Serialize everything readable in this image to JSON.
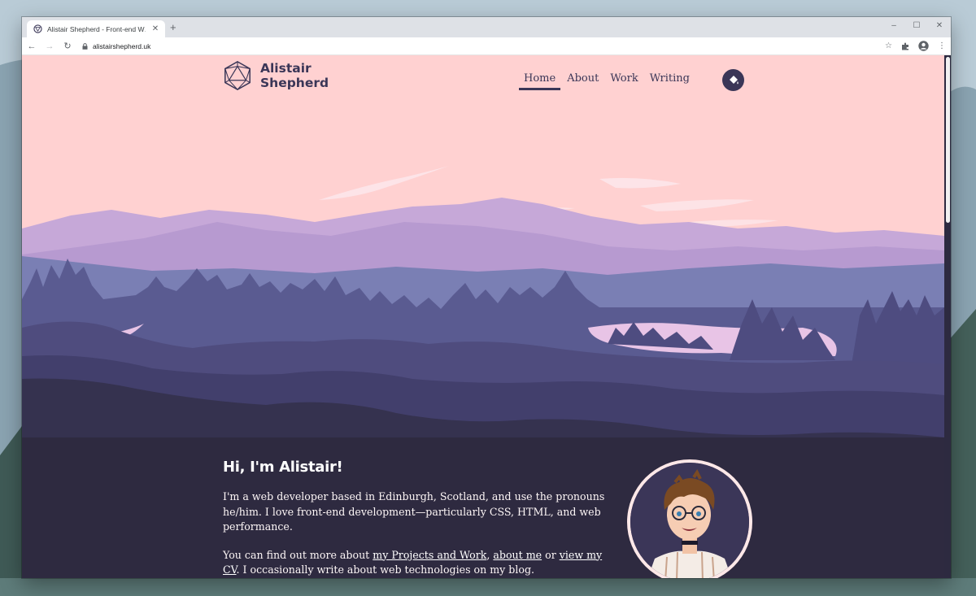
{
  "browser": {
    "tab_title": "Alistair Shepherd - Front-end W…",
    "tab_close": "✕",
    "new_tab": "+",
    "url": "alistairshepherd.uk",
    "controls": {
      "minimize": "–",
      "maximize": "☐",
      "close": "✕"
    }
  },
  "site": {
    "logo_line1": "Alistair",
    "logo_line2": "Shepherd",
    "nav": [
      {
        "label": "Home",
        "active": true
      },
      {
        "label": "About",
        "active": false
      },
      {
        "label": "Work",
        "active": false
      },
      {
        "label": "Writing",
        "active": false
      }
    ]
  },
  "hero": {
    "title": "Hi, I'm Alistair!",
    "para1": "I'm a web developer based in Edinburgh, Scotland, and use the pronouns he/him. I love front-end development—particularly CSS, HTML, and web performance.",
    "para2_prefix": "You can find out more about ",
    "link_projects": "my Projects and Work",
    "sep1": ", ",
    "link_about": "about me",
    "sep2": " or ",
    "link_cv": "view my CV",
    "para2_suffix": ". I occasionally write about web technologies on my blog."
  },
  "colors": {
    "sky": "#ffd1d1",
    "accent_dark": "#3a3657",
    "ground": "#2e2a40"
  },
  "icons": {
    "theme_toggle": "paint-bucket-icon",
    "logo": "icosahedron-logo-icon"
  }
}
